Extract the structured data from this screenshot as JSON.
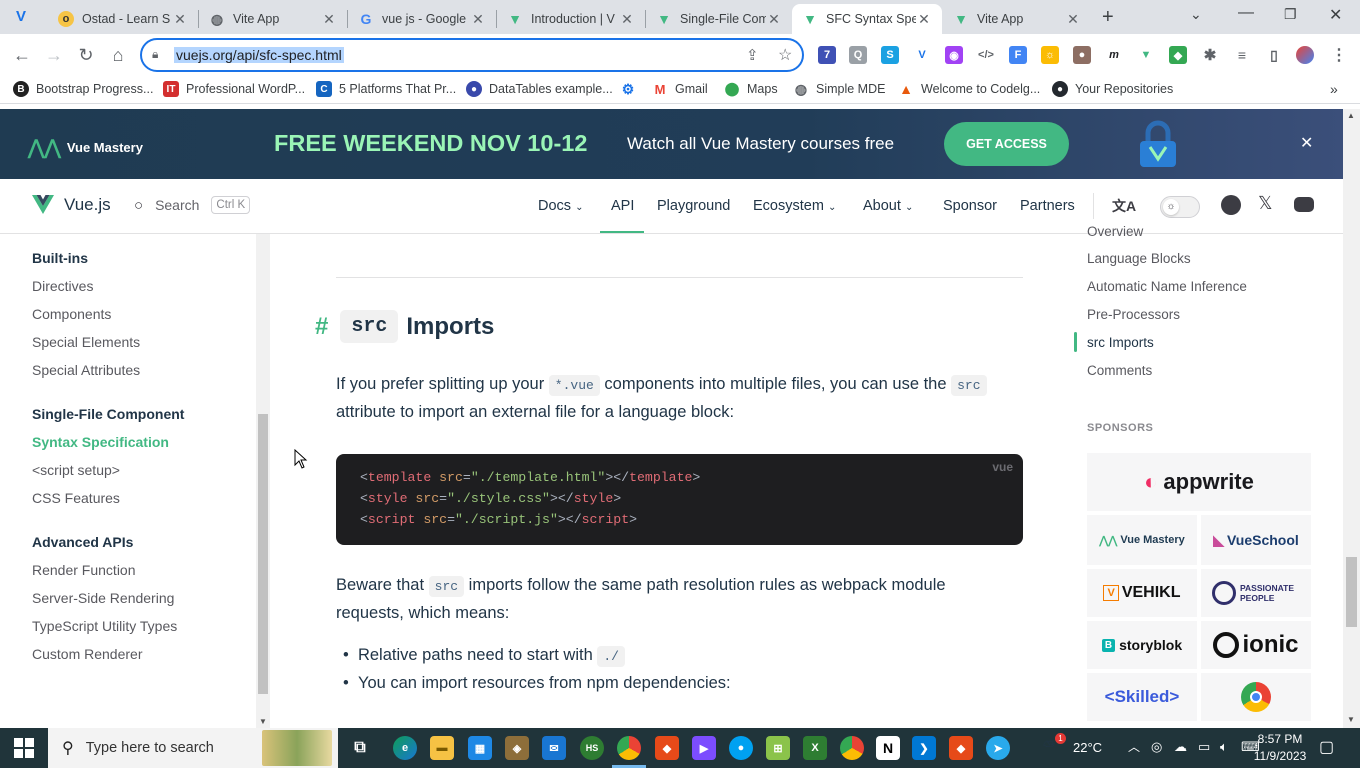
{
  "browser": {
    "tabs": [
      {
        "title": "Ostad - Learn S",
        "icon": "ostad-favicon"
      },
      {
        "title": "Vite App",
        "icon": "globe-favicon"
      },
      {
        "title": "vue js - Google",
        "icon": "google-favicon"
      },
      {
        "title": "Introduction | V",
        "icon": "vue-favicon"
      },
      {
        "title": "Single-File Com",
        "icon": "vue-favicon"
      },
      {
        "title": "SFC Syntax Spe",
        "icon": "vue-favicon",
        "active": true
      },
      {
        "title": "Vite App",
        "icon": "vue-favicon"
      }
    ],
    "url": "vuejs.org/api/sfc-spec.html",
    "bookmarks": [
      "Bootstrap Progress...",
      "Professional WordP...",
      "5 Platforms That Pr...",
      "DataTables example...",
      "Gmail",
      "Maps",
      "Simple MDE",
      "Welcome to Codelg...",
      "Your Repositories"
    ]
  },
  "banner": {
    "brand": "Vue Mastery",
    "headline": "FREE WEEKEND NOV 10-12",
    "subtext": "Watch all Vue Mastery courses free",
    "cta": "GET ACCESS",
    "close": "✕"
  },
  "header": {
    "logo_text": "Vue.js",
    "search_label": "Search",
    "search_shortcut": "Ctrl K",
    "nav": [
      "Docs",
      "API",
      "Playground",
      "Ecosystem",
      "About",
      "Sponsor",
      "Partners"
    ]
  },
  "sidebar": {
    "group1_title": "Built-ins",
    "group1_items": [
      "Directives",
      "Components",
      "Special Elements",
      "Special Attributes"
    ],
    "group2_title": "Single-File Component",
    "group2_items": [
      "Syntax Specification",
      "<script setup>",
      "CSS Features"
    ],
    "group3_title": "Advanced APIs",
    "group3_items": [
      "Render Function",
      "Server-Side Rendering",
      "TypeScript Utility Types",
      "Custom Renderer"
    ]
  },
  "content": {
    "anchor": "#",
    "heading_code": "src",
    "heading_text": "Imports",
    "p1_a": "If you prefer splitting up your",
    "p1_code": "*.vue",
    "p1_b": "components into multiple files, you can use the",
    "p1_code2": "src",
    "p1_c": "attribute to import an external file for a language block:",
    "code_lang": "vue",
    "code_lines": [
      [
        "<",
        "template",
        " src",
        "=",
        "\"./template.html\"",
        "></",
        "template",
        ">"
      ],
      [
        "<",
        "style",
        " src",
        "=",
        "\"./style.css\"",
        "></",
        "style",
        ">"
      ],
      [
        "<",
        "script",
        " src",
        "=",
        "\"./script.js\"",
        "></",
        "script",
        ">"
      ]
    ],
    "p2_a": "Beware that",
    "p2_code": "src",
    "p2_b": "imports follow the same path resolution rules as webpack module",
    "p2_c": "requests, which means:",
    "li1_text": "Relative paths need to start with",
    "li1_code": "./",
    "li2_text": "You can import resources from npm dependencies:"
  },
  "toc": {
    "partial_item": "Overview",
    "items": [
      "Language Blocks",
      "Automatic Name Inference",
      "Pre-Processors",
      "src Imports",
      "Comments"
    ],
    "active": "src Imports",
    "sponsors_title": "SPONSORS",
    "sponsors": [
      "appwrite",
      "Vue Mastery",
      "VueSchool",
      "VEHIKL",
      "PASSIONATE PEOPLE",
      "storyblok",
      "ionic",
      "<Skilled>",
      "chrome"
    ]
  },
  "taskbar": {
    "search_placeholder": "Type here to search",
    "weather": "22°C",
    "time": "8:57 PM",
    "date": "11/9/2023",
    "notification_count": "1"
  }
}
